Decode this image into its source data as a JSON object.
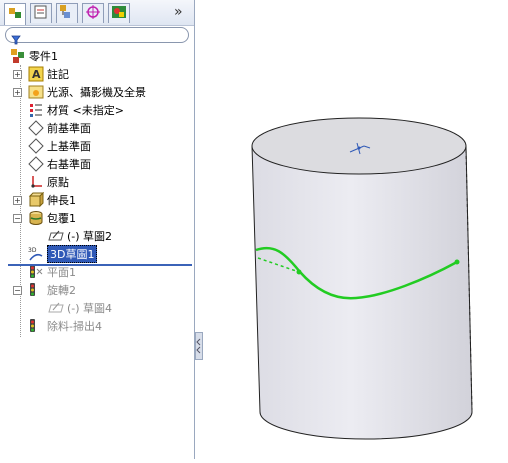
{
  "tabs": [
    {
      "name": "feature-manager",
      "icon": "feature-tree-icon"
    },
    {
      "name": "property-manager",
      "icon": "property-manager-icon"
    },
    {
      "name": "configuration-manager",
      "icon": "configuration-icon"
    },
    {
      "name": "dimxpert-manager",
      "icon": "crosshair-icon"
    },
    {
      "name": "display-manager",
      "icon": "display-icon"
    }
  ],
  "more_label": "»",
  "tree": {
    "root": "零件1",
    "items": [
      {
        "label": "註記",
        "icon": "annotation-icon",
        "expander": "+"
      },
      {
        "label": "光源、攝影機及全景",
        "icon": "lights-cameras-icon",
        "expander": "+"
      },
      {
        "label": "材質 <未指定>",
        "icon": "material-icon",
        "expander": ""
      },
      {
        "label": "前基準面",
        "icon": "plane-icon",
        "expander": ""
      },
      {
        "label": "上基準面",
        "icon": "plane-icon",
        "expander": ""
      },
      {
        "label": "右基準面",
        "icon": "plane-icon",
        "expander": ""
      },
      {
        "label": "原點",
        "icon": "origin-icon",
        "expander": ""
      },
      {
        "label": "伸長1",
        "icon": "extrude-icon",
        "expander": "+"
      },
      {
        "label": "包覆1",
        "icon": "wrap-icon",
        "expander": "-"
      },
      {
        "label": "(-) 草圖2",
        "icon": "sketch-icon",
        "expander": ""
      },
      {
        "label": "3D草圖1",
        "icon": "3d-sketch-icon",
        "expander": ""
      },
      {
        "label": "平面1",
        "icon": "plane-icon",
        "expander": ""
      },
      {
        "label": "旋轉2",
        "icon": "revolve-icon",
        "expander": "-"
      },
      {
        "label": "(-) 草圖4",
        "icon": "sketch-icon",
        "expander": ""
      },
      {
        "label": "除料-掃出4",
        "icon": "cut-sweep-icon",
        "expander": ""
      }
    ]
  },
  "colors": {
    "selection": "#2f59b7",
    "rollback": "#3b63b8",
    "curve": "#22cc22",
    "cylinder_body": "#e6e6ec",
    "cylinder_top": "#d9d9dd"
  }
}
